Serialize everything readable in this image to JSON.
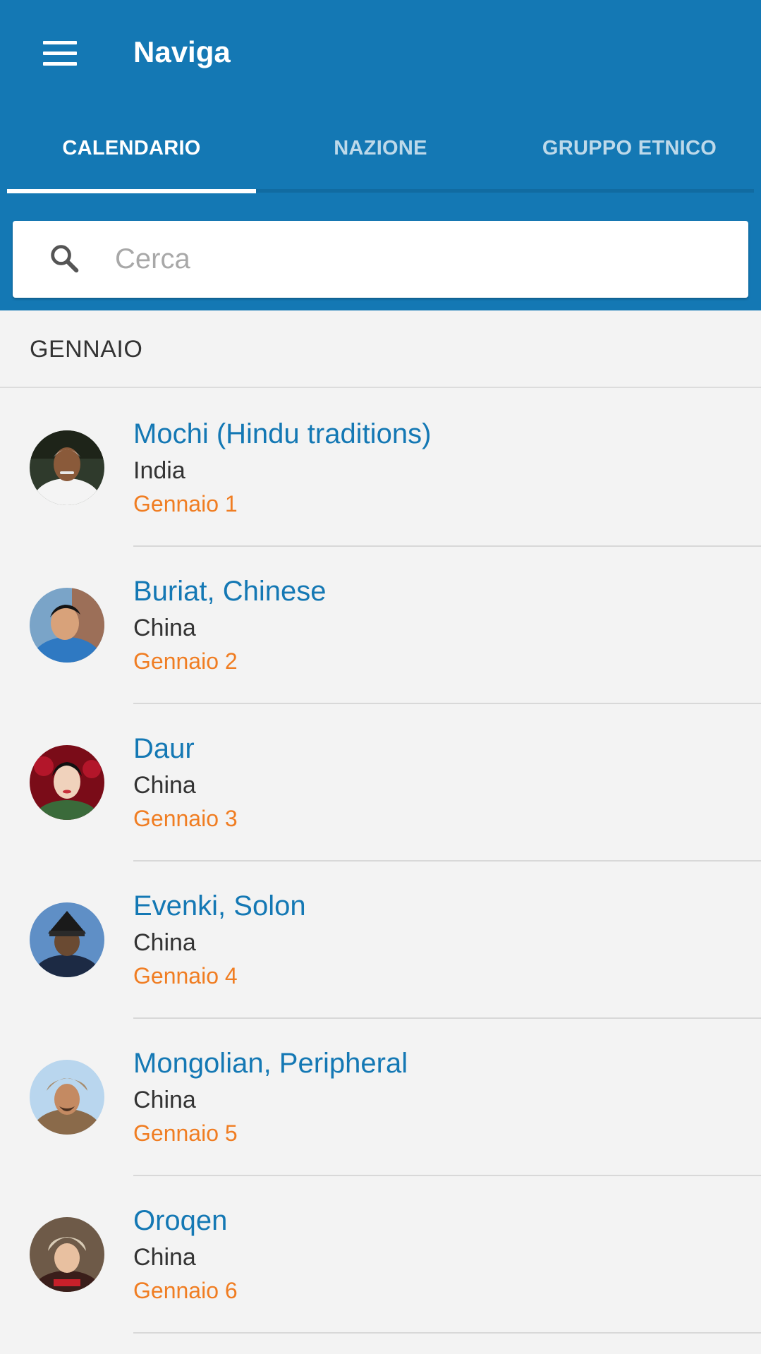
{
  "toolbar": {
    "title": "Naviga"
  },
  "tabs": [
    {
      "label": "CALENDARIO",
      "active": true
    },
    {
      "label": "NAZIONE",
      "active": false
    },
    {
      "label": "GRUPPO ETNICO",
      "active": false
    }
  ],
  "search": {
    "placeholder": "Cerca",
    "value": ""
  },
  "section": {
    "header": "GENNAIO"
  },
  "items": [
    {
      "name": "Mochi (Hindu traditions)",
      "country": "India",
      "date": "Gennaio 1"
    },
    {
      "name": "Buriat, Chinese",
      "country": "China",
      "date": "Gennaio 2"
    },
    {
      "name": "Daur",
      "country": "China",
      "date": "Gennaio 3"
    },
    {
      "name": "Evenki, Solon",
      "country": "China",
      "date": "Gennaio 4"
    },
    {
      "name": "Mongolian, Peripheral",
      "country": "China",
      "date": "Gennaio 5"
    },
    {
      "name": "Oroqen",
      "country": "China",
      "date": "Gennaio 6"
    }
  ],
  "colors": {
    "primary": "#1478b4",
    "name_text": "#1478b4",
    "date_text": "#f07d22",
    "background": "#f3f3f3"
  }
}
